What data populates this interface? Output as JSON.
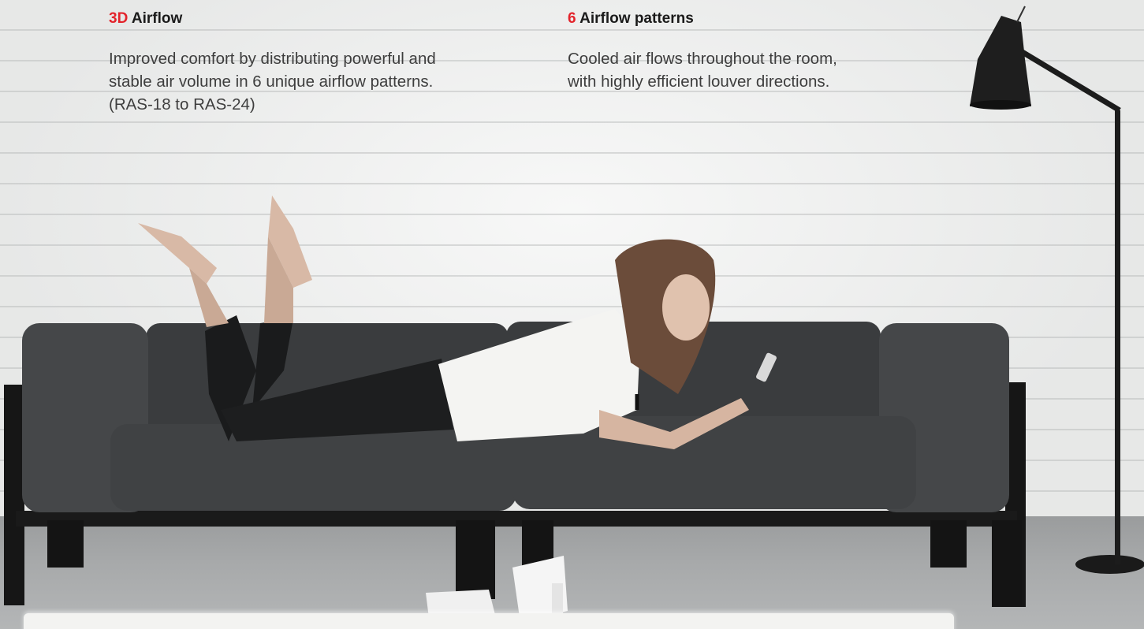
{
  "features": [
    {
      "title_accent": "3D",
      "title_rest": " Airflow",
      "body_lines": [
        "Improved comfort by distributing powerful and",
        "stable air volume in 6 unique airflow patterns.",
        "(RAS-18 to RAS-24)"
      ]
    },
    {
      "title_accent": "6",
      "title_rest": " Airflow patterns",
      "body_lines": [
        "Cooled air flows throughout the room,",
        "with highly efficient louver directions."
      ]
    }
  ],
  "colors": {
    "accent": "#e3232b",
    "wall": "#ecedec",
    "sofa": "#3f4143",
    "floor": "#a7a9aa"
  }
}
